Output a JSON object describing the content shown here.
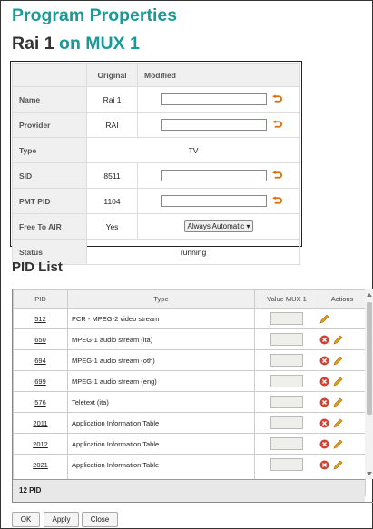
{
  "title": "Program Properties",
  "subtitle": {
    "program": "Rai 1",
    "suffix": "on MUX 1"
  },
  "properties": {
    "header": {
      "original": "Original",
      "modified": "Modified"
    },
    "rows": {
      "name": {
        "label": "Name",
        "original": "Rai 1"
      },
      "provider": {
        "label": "Provider",
        "original": "RAI"
      },
      "type": {
        "label": "Type",
        "value": "TV"
      },
      "sid": {
        "label": "SID",
        "original": "8511"
      },
      "pmt_pid": {
        "label": "PMT PID",
        "original": "1104"
      },
      "free_to_air": {
        "label": "Free To AIR",
        "original": "Yes",
        "select": "Always Automatic"
      },
      "status": {
        "label": "Status",
        "value": "running"
      }
    }
  },
  "pid_list": {
    "title": "PID List",
    "columns": {
      "pid": "PID",
      "type": "Type",
      "value": "Value MUX 1",
      "actions": "Actions"
    },
    "rows": [
      {
        "pid": "512",
        "type": "PCR - MPEG-2 video stream"
      },
      {
        "pid": "650",
        "type": "MPEG-1 audio stream (ita)"
      },
      {
        "pid": "694",
        "type": "MPEG-1 audio stream (oth)"
      },
      {
        "pid": "699",
        "type": "MPEG-1 audio stream (eng)"
      },
      {
        "pid": "576",
        "type": "Teletext (ita)"
      },
      {
        "pid": "2011",
        "type": "Application Information Table"
      },
      {
        "pid": "2012",
        "type": "Application Information Table"
      },
      {
        "pid": "2021",
        "type": "Application Information Table"
      }
    ],
    "footer": "12 PID"
  },
  "buttons": {
    "ok": "OK",
    "apply": "Apply",
    "close": "Close"
  },
  "icons": {
    "undo": "undo-arrow-icon",
    "delete": "delete-icon",
    "edit": "pencil-edit-icon"
  },
  "colors": {
    "accent": "#1a9a96",
    "undo": "#e66a00",
    "delete": "#d6402f",
    "edit": "#e0a020"
  }
}
